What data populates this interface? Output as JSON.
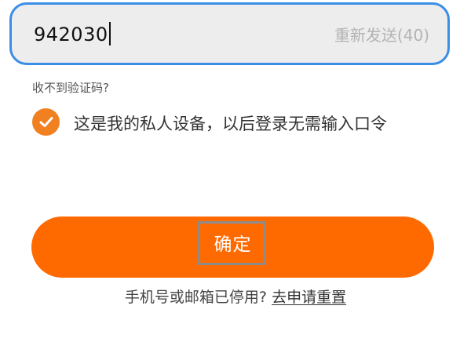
{
  "verification": {
    "code_value": "942030",
    "resend_label": "重新发送(40)"
  },
  "help": {
    "no_code_label": "收不到验证码?"
  },
  "trusted_device": {
    "checked": true,
    "label": "这是我的私人设备，以后登录无需输入口令"
  },
  "actions": {
    "confirm_label": "确定"
  },
  "footer": {
    "prompt": "手机号或邮箱已停用?",
    "reset_link": "去申请重置"
  },
  "colors": {
    "accent": "#ff6a00",
    "checkbox": "#f08020",
    "field_border": "#3a8ee6",
    "field_background": "#ededed"
  }
}
